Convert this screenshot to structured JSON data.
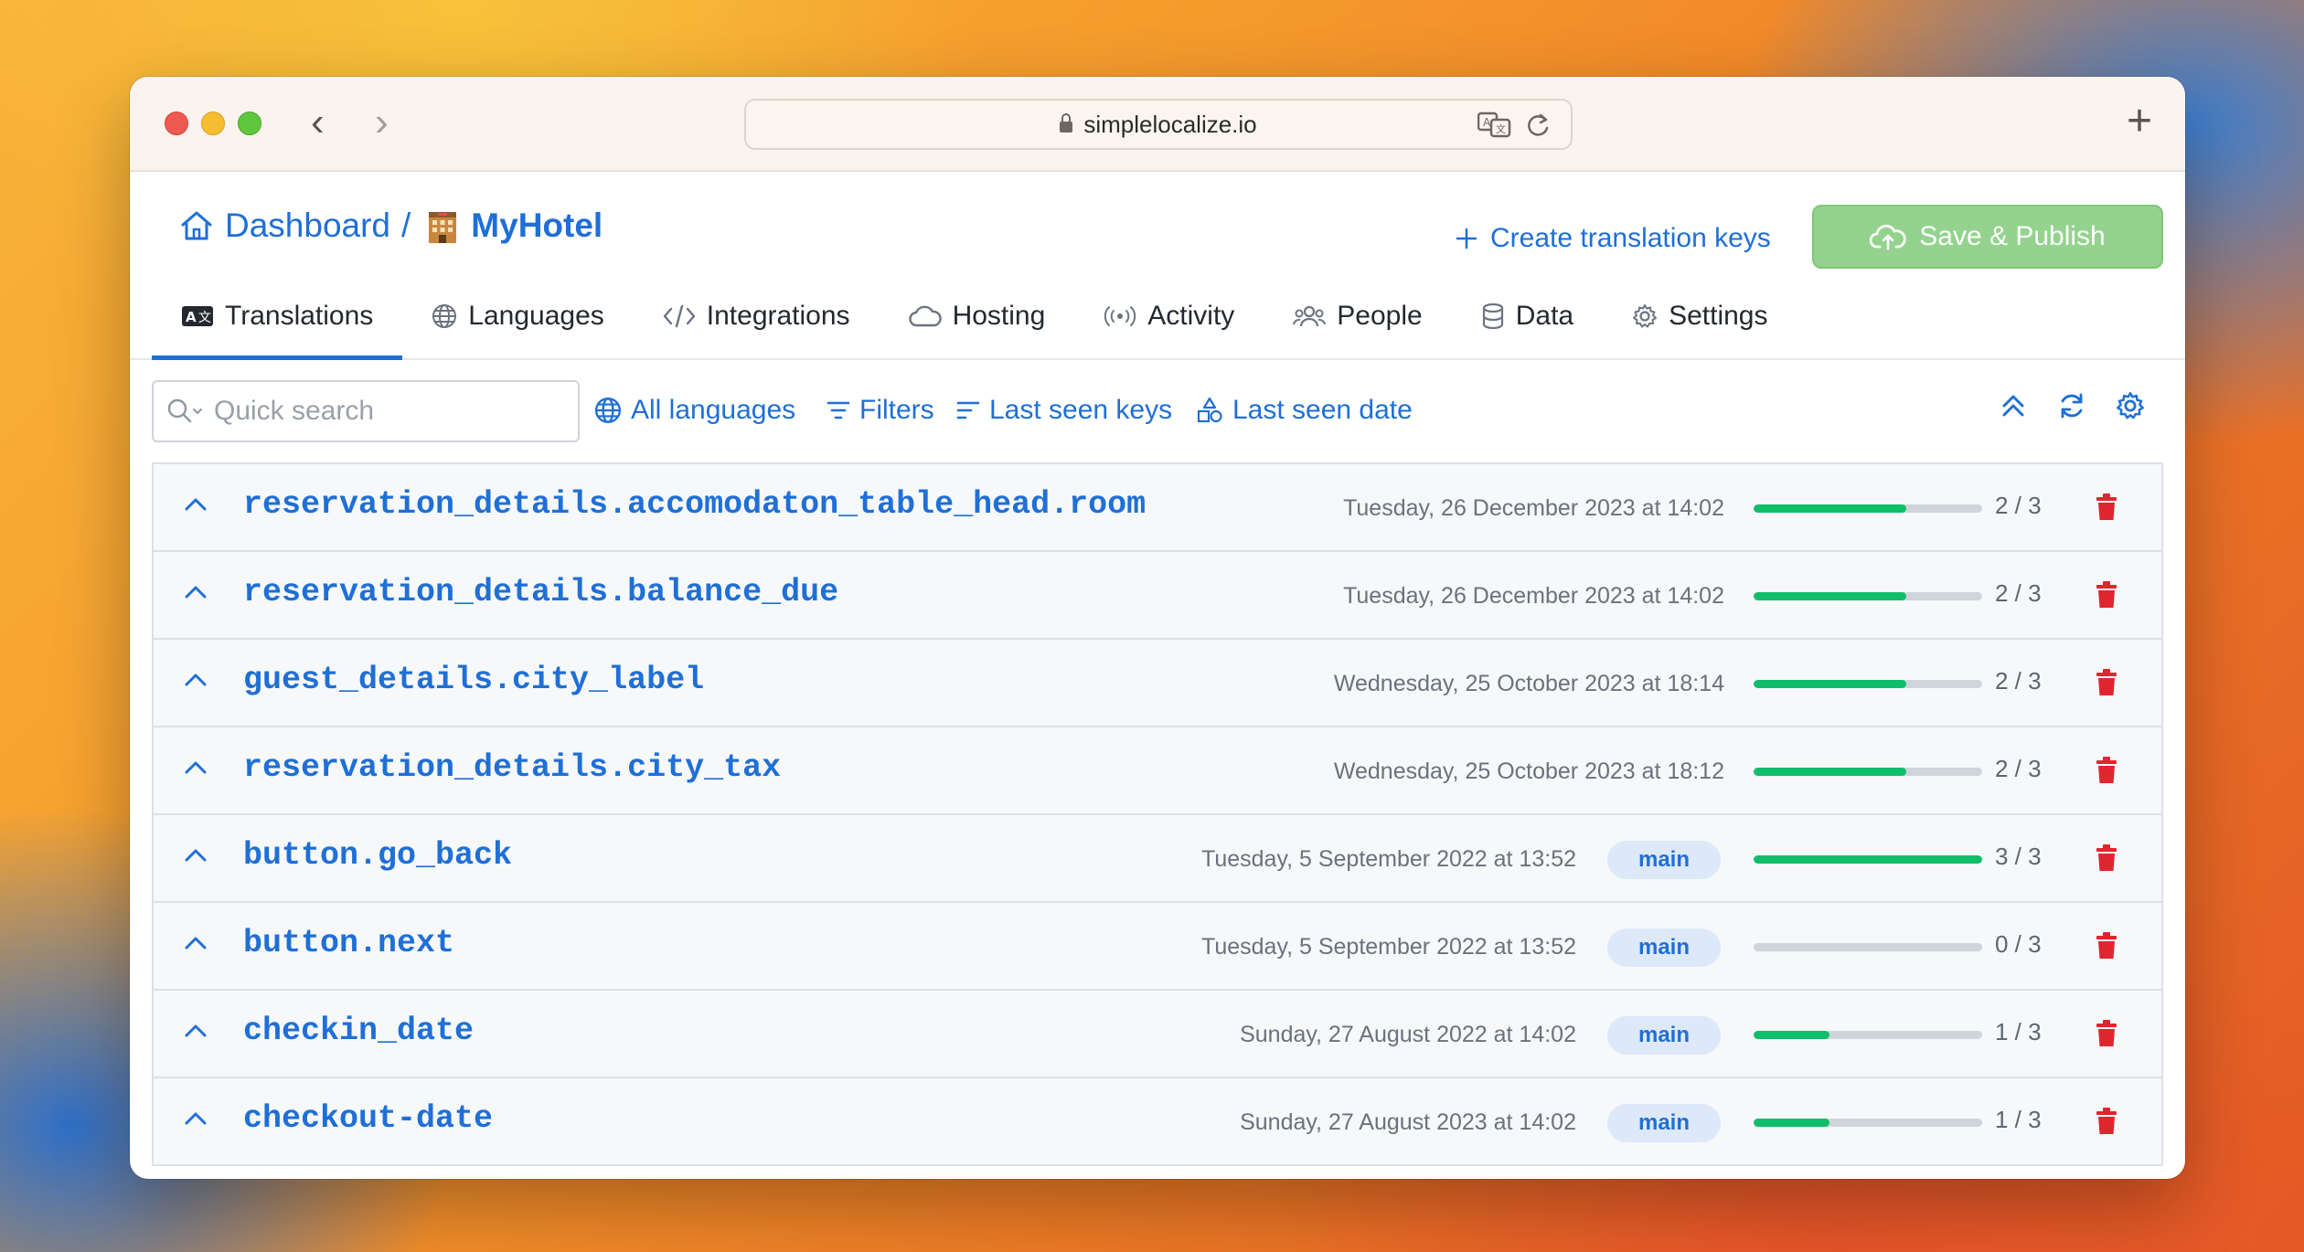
{
  "browser": {
    "url": "simplelocalize.io"
  },
  "header": {
    "breadcrumb_home": "Dashboard",
    "breadcrumb_sep": "/",
    "project_name": "MyHotel",
    "create_keys_label": "Create translation keys",
    "save_label": "Save & Publish"
  },
  "tabs": [
    {
      "label": "Translations",
      "icon": "translation-icon",
      "active": true
    },
    {
      "label": "Languages",
      "icon": "globe-icon"
    },
    {
      "label": "Integrations",
      "icon": "code-icon"
    },
    {
      "label": "Hosting",
      "icon": "cloud-icon"
    },
    {
      "label": "Activity",
      "icon": "broadcast-icon"
    },
    {
      "label": "People",
      "icon": "people-icon"
    },
    {
      "label": "Data",
      "icon": "database-icon"
    },
    {
      "label": "Settings",
      "icon": "gear-icon"
    }
  ],
  "toolbar": {
    "search_placeholder": "Quick search",
    "all_languages": "All languages",
    "filters": "Filters",
    "last_seen_keys": "Last seen keys",
    "last_seen_date": "Last seen date"
  },
  "rows": [
    {
      "key": "reservation_details.accomodaton_table_head.room",
      "date": "Tuesday, 26 December 2023 at 14:02",
      "badge": "",
      "progress": "2 / 3",
      "fraction": 0.6667
    },
    {
      "key": "reservation_details.balance_due",
      "date": "Tuesday, 26 December 2023 at 14:02",
      "badge": "",
      "progress": "2 / 3",
      "fraction": 0.6667
    },
    {
      "key": "guest_details.city_label",
      "date": "Wednesday, 25 October 2023 at 18:14",
      "badge": "",
      "progress": "2 / 3",
      "fraction": 0.6667
    },
    {
      "key": "reservation_details.city_tax",
      "date": "Wednesday, 25 October 2023 at 18:12",
      "badge": "",
      "progress": "2 / 3",
      "fraction": 0.6667
    },
    {
      "key": "button.go_back",
      "date": "Tuesday, 5 September 2022 at 13:52",
      "badge": "main",
      "progress": "3 / 3",
      "fraction": 1.0
    },
    {
      "key": "button.next",
      "date": "Tuesday, 5 September 2022 at 13:52",
      "badge": "main",
      "progress": "0 / 3",
      "fraction": 0.0
    },
    {
      "key": "checkin_date",
      "date": "Sunday, 27 August 2022 at 14:02",
      "badge": "main",
      "progress": "1 / 3",
      "fraction": 0.3333
    },
    {
      "key": "checkout-date",
      "date": "Sunday, 27 August 2023 at 14:02",
      "badge": "main",
      "progress": "1 / 3",
      "fraction": 0.3333
    }
  ],
  "colors": {
    "accent": "#1f6fd6",
    "progress": "#0fbd6a",
    "delete": "#e0252f",
    "save_button": "#93d38d"
  }
}
